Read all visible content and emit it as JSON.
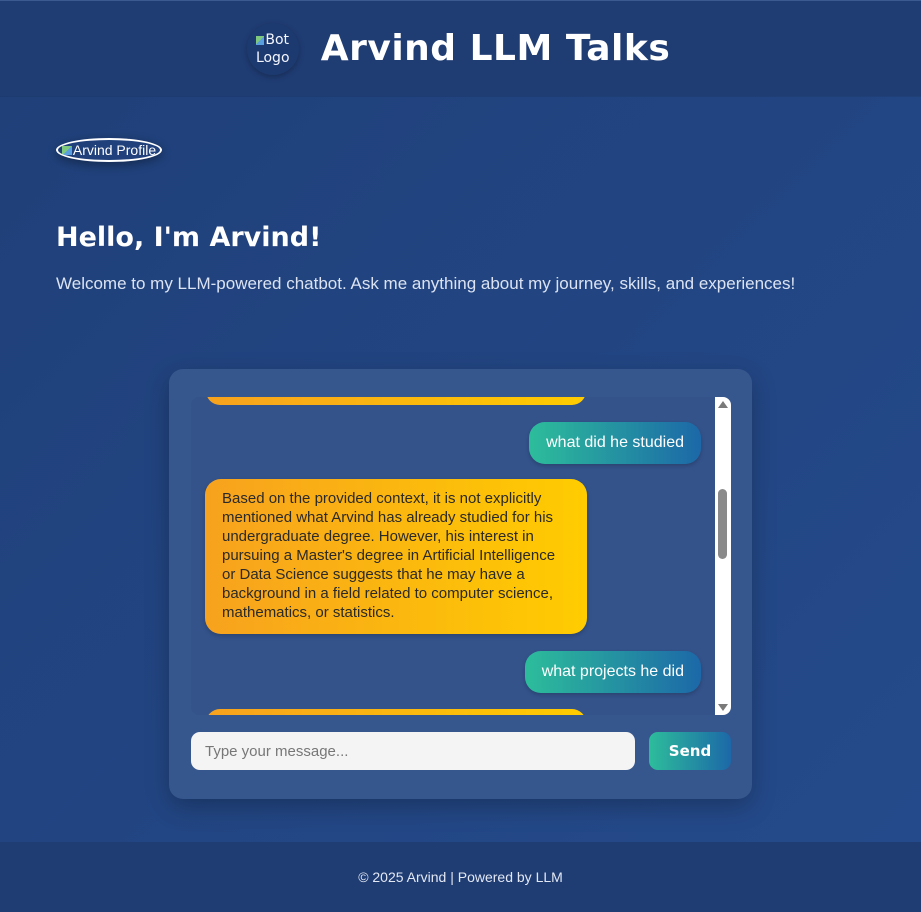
{
  "header": {
    "logo_alt": "Bot Logo",
    "title": "Arvind LLM Talks"
  },
  "profile": {
    "alt": "Arvind Profile"
  },
  "intro": {
    "heading": "Hello, I'm Arvind!",
    "subtext": "Welcome to my LLM-powered chatbot. Ask me anything about my journey, skills, and experiences!"
  },
  "chat": {
    "messages": [
      {
        "role": "user",
        "text": "what did he studied"
      },
      {
        "role": "bot",
        "text": "Based on the provided context, it is not explicitly mentioned what Arvind has already studied for his undergraduate degree. However, his interest in pursuing a Master's degree in Artificial Intelligence or Data Science suggests that he may have a background in a field related to computer science, mathematics, or statistics."
      },
      {
        "role": "user",
        "text": "what projects he did"
      }
    ],
    "input_placeholder": "Type your message...",
    "send_label": "Send"
  },
  "footer": {
    "text": "© 2025 Arvind | Powered by LLM"
  },
  "colors": {
    "background": "#254b8c",
    "header": "#1f3c73",
    "chat_card": "#36568e",
    "bot_bubble": "#ffcc00",
    "user_bubble": "#2dbd9b"
  }
}
